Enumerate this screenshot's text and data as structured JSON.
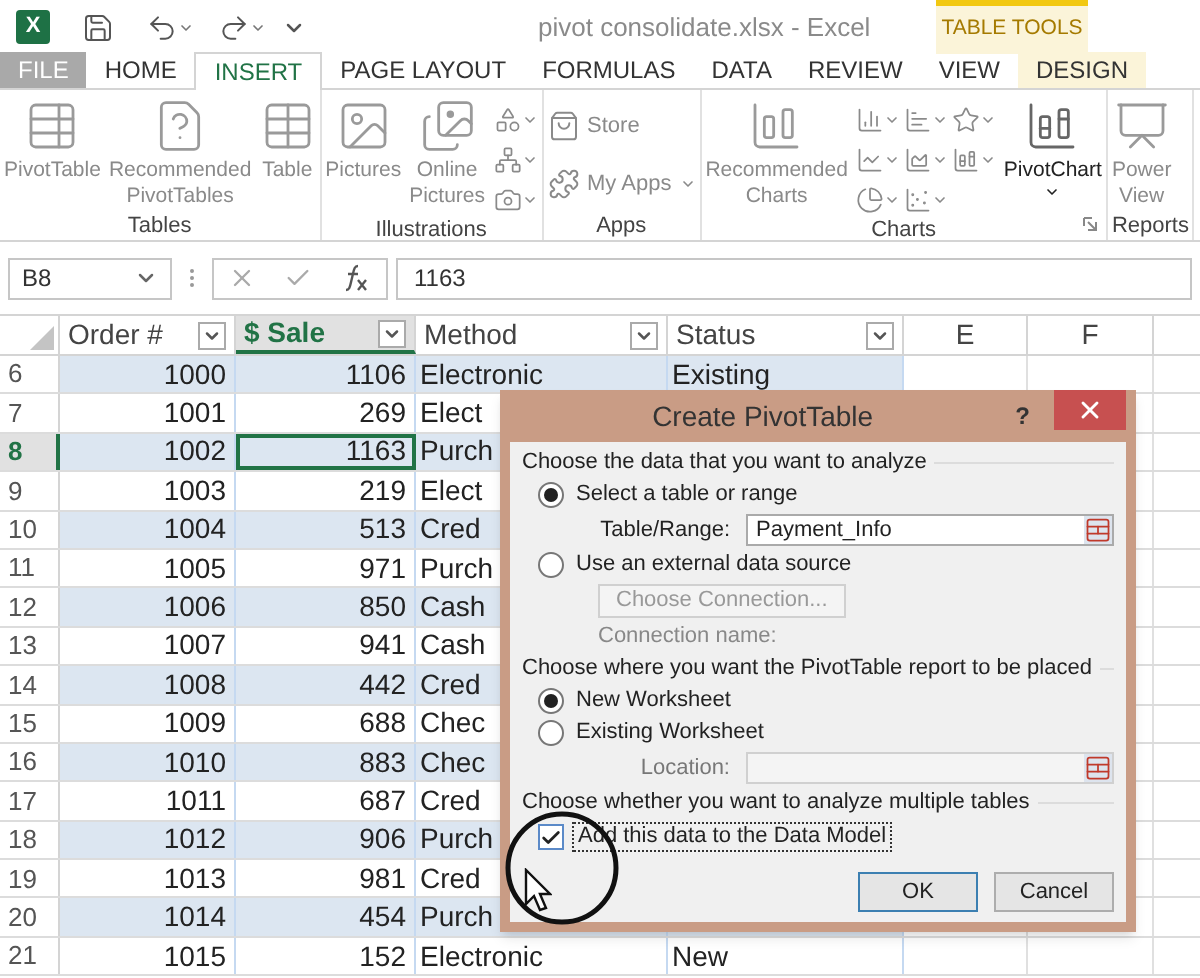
{
  "title_bar": {
    "logo": "X",
    "title": "pivot consolidate.xlsx - Excel",
    "context_label": "TABLE TOOLS"
  },
  "tabs": [
    {
      "label": "FILE",
      "kind": "file",
      "selected": false
    },
    {
      "label": "HOME",
      "kind": "normal",
      "selected": false
    },
    {
      "label": "INSERT",
      "kind": "normal",
      "selected": true
    },
    {
      "label": "PAGE LAYOUT",
      "kind": "normal",
      "selected": false
    },
    {
      "label": "FORMULAS",
      "kind": "normal",
      "selected": false
    },
    {
      "label": "DATA",
      "kind": "normal",
      "selected": false
    },
    {
      "label": "REVIEW",
      "kind": "normal",
      "selected": false
    },
    {
      "label": "VIEW",
      "kind": "normal",
      "selected": false
    },
    {
      "label": "DESIGN",
      "kind": "context",
      "selected": false
    }
  ],
  "ribbon": [
    {
      "label": "Tables",
      "items": [
        {
          "kind": "pivottable",
          "label": "PivotTable",
          "disabled": true
        },
        {
          "kind": "recommendedpivot",
          "label": "Recommended PivotTables",
          "disabled": true
        },
        {
          "kind": "table",
          "label": "Table",
          "disabled": true
        }
      ]
    },
    {
      "label": "Illustrations",
      "items": [
        {
          "kind": "pictures",
          "label": "Pictures",
          "disabled": true
        },
        {
          "kind": "onlinepictures",
          "label": "Online Pictures",
          "disabled": true
        },
        {
          "kind": "illustrationtools",
          "disabled": true
        }
      ]
    },
    {
      "label": "Apps",
      "items": [
        {
          "kind": "apps",
          "entries": [
            {
              "kind": "store",
              "label": "Store",
              "disabled": true
            },
            {
              "kind": "myapps",
              "label": "My Apps",
              "disabled": true
            }
          ]
        }
      ]
    },
    {
      "label": "Charts",
      "launcher": true,
      "items": [
        {
          "kind": "recommendedcharts",
          "label": "Recommended Charts",
          "disabled": true
        },
        {
          "kind": "charttypes",
          "disabled": true
        },
        {
          "kind": "pivotchart",
          "label": "PivotChart",
          "disabled": false
        }
      ]
    },
    {
      "label": "Reports",
      "items": [
        {
          "kind": "powerview",
          "label": "Power View",
          "disabled": true
        }
      ]
    }
  ],
  "formula_bar": {
    "name_box": "B8",
    "value": "1163"
  },
  "sheet": {
    "columns": [
      {
        "label": "Order #",
        "filter": true,
        "selected": false
      },
      {
        "label": "$ Sale",
        "filter": true,
        "selected": true
      },
      {
        "label": "Method",
        "filter": true,
        "selected": false
      },
      {
        "label": "Status",
        "filter": true,
        "selected": false
      },
      {
        "label": "E",
        "filter": false,
        "selected": false
      },
      {
        "label": "F",
        "filter": false,
        "selected": false
      }
    ],
    "rows": [
      {
        "number": "6",
        "banded": true,
        "selected": false,
        "cells": [
          "1000",
          "1106",
          "Electronic",
          "Existing"
        ]
      },
      {
        "number": "7",
        "banded": false,
        "selected": false,
        "cells": [
          "1001",
          "269",
          "Elect"
        ]
      },
      {
        "number": "8",
        "banded": true,
        "selected": true,
        "cells": [
          "1002",
          "1163",
          "Purch"
        ]
      },
      {
        "number": "9",
        "banded": false,
        "selected": false,
        "cells": [
          "1003",
          "219",
          "Elect"
        ]
      },
      {
        "number": "10",
        "banded": true,
        "selected": false,
        "cells": [
          "1004",
          "513",
          "Cred"
        ]
      },
      {
        "number": "11",
        "banded": false,
        "selected": false,
        "cells": [
          "1005",
          "971",
          "Purch"
        ]
      },
      {
        "number": "12",
        "banded": true,
        "selected": false,
        "cells": [
          "1006",
          "850",
          "Cash"
        ]
      },
      {
        "number": "13",
        "banded": false,
        "selected": false,
        "cells": [
          "1007",
          "941",
          "Cash"
        ]
      },
      {
        "number": "14",
        "banded": true,
        "selected": false,
        "cells": [
          "1008",
          "442",
          "Cred"
        ]
      },
      {
        "number": "15",
        "banded": false,
        "selected": false,
        "cells": [
          "1009",
          "688",
          "Chec"
        ]
      },
      {
        "number": "16",
        "banded": true,
        "selected": false,
        "cells": [
          "1010",
          "883",
          "Chec"
        ]
      },
      {
        "number": "17",
        "banded": false,
        "selected": false,
        "cells": [
          "1011",
          "687",
          "Cred"
        ]
      },
      {
        "number": "18",
        "banded": true,
        "selected": false,
        "cells": [
          "1012",
          "906",
          "Purch"
        ]
      },
      {
        "number": "19",
        "banded": false,
        "selected": false,
        "cells": [
          "1013",
          "981",
          "Cred"
        ]
      },
      {
        "number": "20",
        "banded": true,
        "selected": false,
        "cells": [
          "1014",
          "454",
          "Purch"
        ]
      },
      {
        "number": "21",
        "banded": false,
        "selected": false,
        "cells": [
          "1015",
          "152",
          "Electronic",
          "New"
        ]
      }
    ]
  },
  "dialog": {
    "title": "Create PivotTable",
    "help": "?",
    "sections": [
      {
        "heading": "Choose the data that you want to analyze",
        "items": [
          {
            "kind": "radio",
            "label": "Select a table or range",
            "selected": true
          },
          {
            "kind": "field",
            "label": "Table/Range:",
            "value": "Payment_Info",
            "disabled": false
          },
          {
            "kind": "radio",
            "label": "Use an external data source",
            "selected": false
          },
          {
            "kind": "button",
            "label": "Choose Connection...",
            "disabled": true
          },
          {
            "kind": "caption",
            "label": "Connection name:",
            "disabled": true
          }
        ]
      },
      {
        "heading": "Choose where you want the PivotTable report to be placed",
        "items": [
          {
            "kind": "radio",
            "label": "New Worksheet",
            "selected": true
          },
          {
            "kind": "radio",
            "label": "Existing Worksheet",
            "selected": false
          },
          {
            "kind": "field",
            "label": "Location:",
            "disabled": true
          }
        ]
      },
      {
        "heading": "Choose whether you want to analyze multiple tables",
        "items": [
          {
            "kind": "checkbox",
            "label": "Add this data to the Data Model",
            "checked": true
          }
        ]
      }
    ],
    "buttons": [
      {
        "label": "OK",
        "default": true
      },
      {
        "label": "Cancel",
        "default": false
      }
    ]
  }
}
